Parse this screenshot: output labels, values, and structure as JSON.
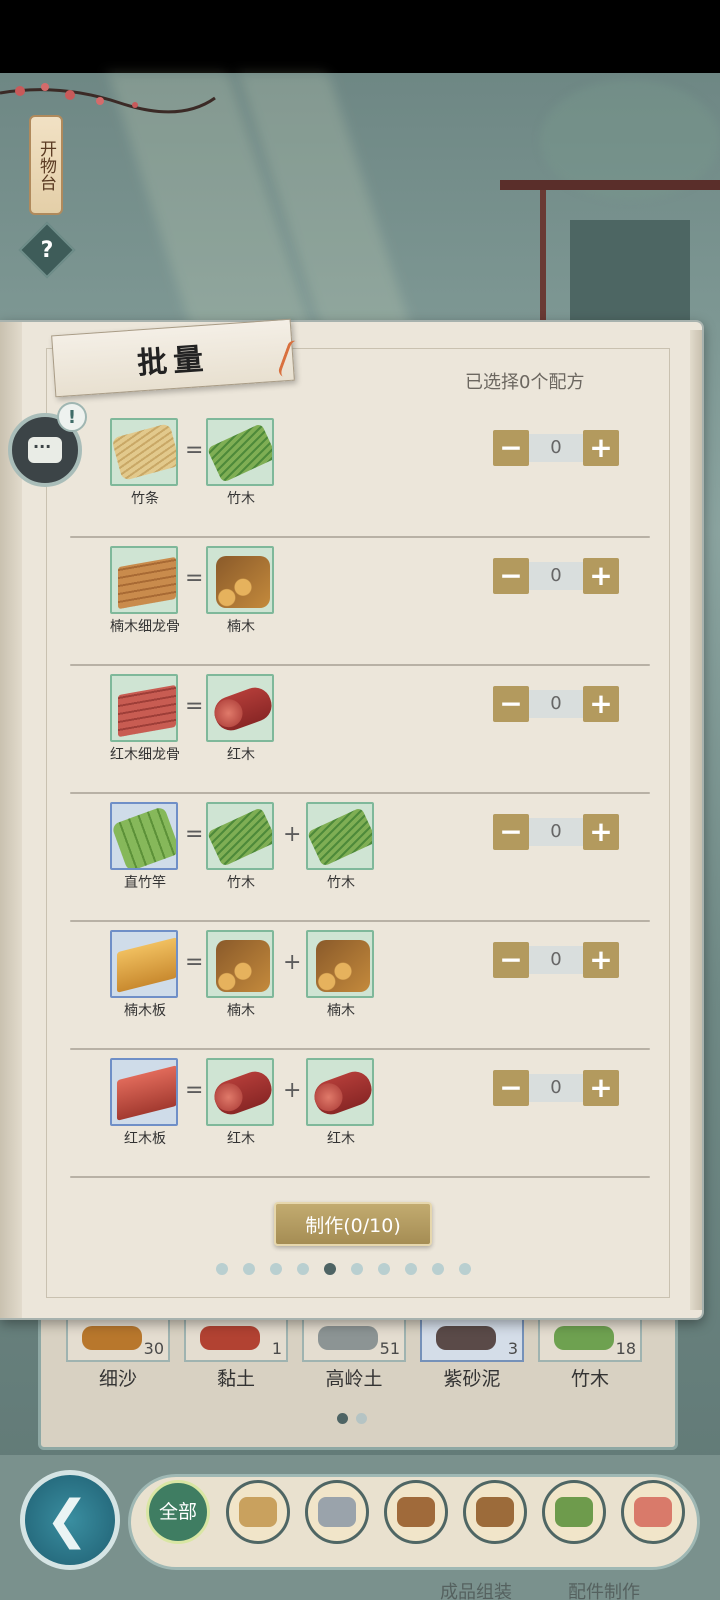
{
  "header": {
    "workbench_title": "开物台",
    "help_label": "?"
  },
  "panel": {
    "title": "批量",
    "selected_count_text": "已选择0个配方",
    "alert_badge": "!",
    "craft_button_label": "制作(0/10)",
    "page_count": 10,
    "active_page_index": 4
  },
  "recipes": [
    {
      "output": {
        "name": "竹条",
        "icon": "bamboo-strips-icon"
      },
      "inputs": [
        {
          "name": "竹木",
          "icon": "bamboo-icon"
        }
      ],
      "qty": "0"
    },
    {
      "output": {
        "name": "楠木细龙骨",
        "icon": "nanmu-keel-icon"
      },
      "inputs": [
        {
          "name": "楠木",
          "icon": "nanmu-log-icon"
        }
      ],
      "qty": "0"
    },
    {
      "output": {
        "name": "红木细龙骨",
        "icon": "redwood-keel-icon"
      },
      "inputs": [
        {
          "name": "红木",
          "icon": "redwood-log-icon"
        }
      ],
      "qty": "0"
    },
    {
      "output": {
        "name": "直竹竿",
        "icon": "bamboo-poles-icon"
      },
      "inputs": [
        {
          "name": "竹木",
          "icon": "bamboo-icon"
        },
        {
          "name": "竹木",
          "icon": "bamboo-icon"
        }
      ],
      "qty": "0"
    },
    {
      "output": {
        "name": "楠木板",
        "icon": "nanmu-board-icon"
      },
      "inputs": [
        {
          "name": "楠木",
          "icon": "nanmu-log-icon"
        },
        {
          "name": "楠木",
          "icon": "nanmu-log-icon"
        }
      ],
      "qty": "0"
    },
    {
      "output": {
        "name": "红木板",
        "icon": "redwood-board-icon"
      },
      "inputs": [
        {
          "name": "红木",
          "icon": "redwood-log-icon"
        },
        {
          "name": "红木",
          "icon": "redwood-log-icon"
        }
      ],
      "qty": "0"
    }
  ],
  "operators": {
    "equals": "=",
    "plus": "+"
  },
  "stepper": {
    "minus": "−",
    "plus": "+"
  },
  "inventory": {
    "items": [
      {
        "name": "细沙",
        "count": "30"
      },
      {
        "name": "黏土",
        "count": "1"
      },
      {
        "name": "高岭土",
        "count": "51"
      },
      {
        "name": "紫砂泥",
        "count": "3"
      },
      {
        "name": "竹木",
        "count": "18"
      }
    ],
    "page_count": 2,
    "active_page_index": 0
  },
  "categories": {
    "all_label": "全部",
    "items": [
      "bamboo-scroll-icon",
      "stone-icon",
      "logs-icon",
      "soil-icon",
      "bamboo-tube-icon",
      "paper-icon"
    ]
  },
  "back_icon": "back-arrow-icon",
  "bottom_tabs": [
    "成品组装",
    "配件制作"
  ],
  "colors": {
    "accent_gold": "#b39a5e",
    "frame_green": "#7fb89a",
    "frame_blue": "#6f8fc7",
    "active_green": "#3f7d62"
  }
}
